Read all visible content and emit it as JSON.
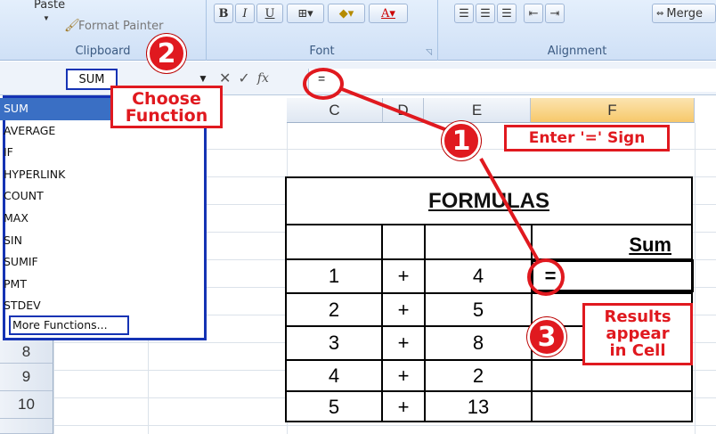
{
  "ribbon": {
    "clipboard": {
      "paste_label": "Paste",
      "format_painter_label": "Format Painter",
      "group_label": "Clipboard"
    },
    "font": {
      "group_label": "Font",
      "bold": "B",
      "italic": "I",
      "underline": "U"
    },
    "alignment": {
      "group_label": "Alignment",
      "merge_label": "Merge"
    }
  },
  "formula_bar": {
    "name_box": "SUM",
    "cancel_glyph": "✕",
    "enter_glyph": "✓",
    "fx_label": "fx",
    "input_value": "="
  },
  "function_list": {
    "items": [
      "SUM",
      "AVERAGE",
      "IF",
      "HYPERLINK",
      "COUNT",
      "MAX",
      "SIN",
      "SUMIF",
      "PMT",
      "STDEV"
    ],
    "more_label": "More Functions..."
  },
  "sheet": {
    "columns": [
      "C",
      "D",
      "E",
      "F"
    ],
    "rows": [
      "8",
      "9",
      "10"
    ]
  },
  "table": {
    "title": "FORMULAS",
    "sum_header": "Sum",
    "rows": [
      {
        "a": "1",
        "op": "+",
        "b": "4",
        "result": "="
      },
      {
        "a": "2",
        "op": "+",
        "b": "5"
      },
      {
        "a": "3",
        "op": "+",
        "b": "8"
      },
      {
        "a": "4",
        "op": "+",
        "b": "2"
      },
      {
        "a": "5",
        "op": "+",
        "b": "13"
      }
    ]
  },
  "callouts": {
    "step1": {
      "number": "1",
      "text": "Enter '=' Sign"
    },
    "step2": {
      "number": "2",
      "line1": "Choose",
      "line2": "Function"
    },
    "step3": {
      "number": "3",
      "line1": "Results",
      "line2": "appear",
      "line3": "in Cell"
    }
  },
  "colors": {
    "accent_red": "#e0191f",
    "accent_blue": "#1533b4",
    "selection": "#3a6fc4"
  }
}
